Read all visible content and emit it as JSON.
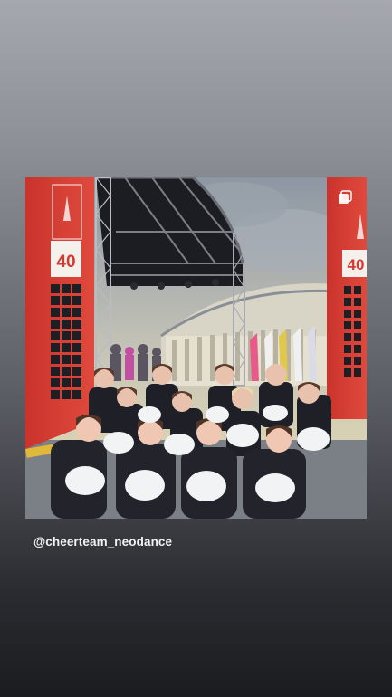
{
  "story": {
    "mention": "@cheerteam_neodance"
  },
  "photo": {
    "banner_number": "40",
    "banner_number_right": "40"
  }
}
